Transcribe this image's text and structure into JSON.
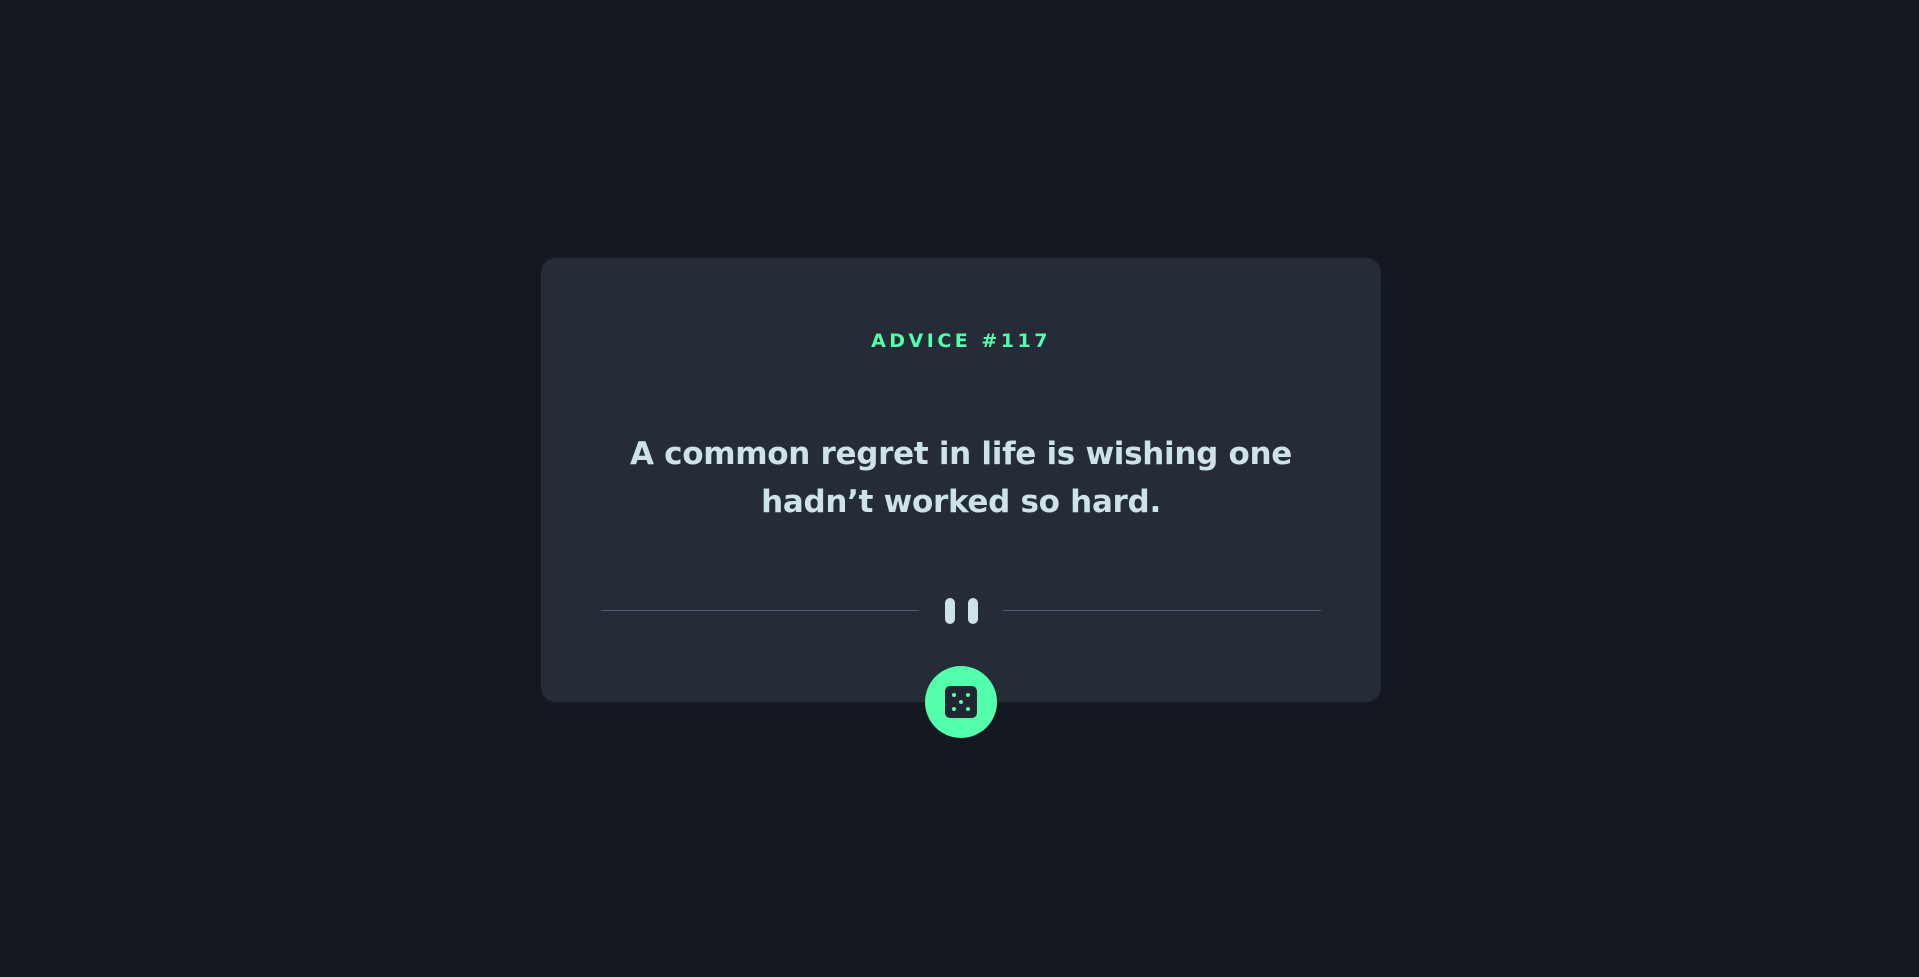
{
  "advice": {
    "label": "ADVICE #117",
    "text": "A common regret in life is wishing one hadn’t worked so hard."
  },
  "icons": {
    "divider": "pause-divider-icon",
    "generate": "dice-icon"
  },
  "colors": {
    "background": "#141820",
    "card": "#252b37",
    "accent": "#53ffab",
    "text": "#cee3e9",
    "divider_line": "#4f5d74"
  }
}
